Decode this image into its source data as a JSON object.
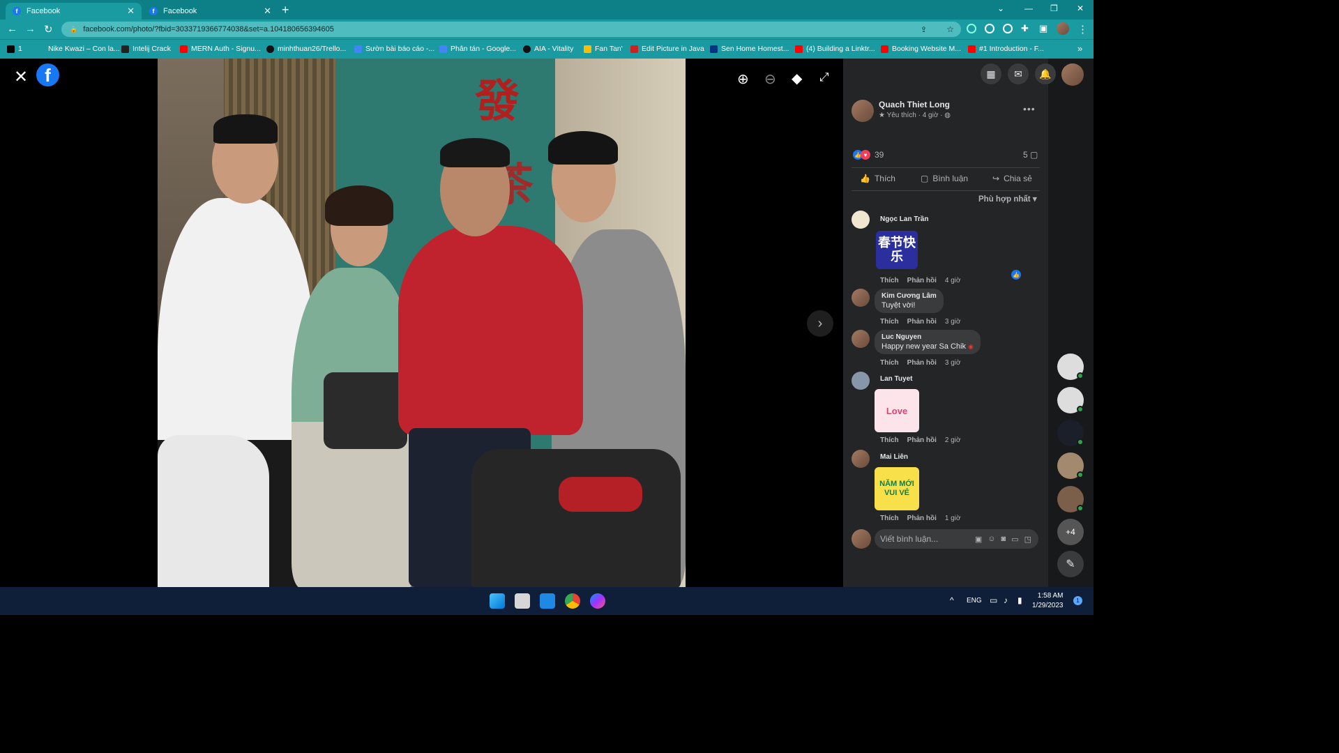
{
  "browser": {
    "tabs": [
      {
        "title": "Facebook",
        "active": true
      },
      {
        "title": "Facebook",
        "active": false
      }
    ],
    "new_tab": "+",
    "url": "facebook.com/photo/?fbid=3033719366774038&set=a.104180656394605",
    "bookmarks": [
      "1",
      "Nike Kwazi – Con la...",
      "Intelij Crack",
      "MERN Auth - Signu...",
      "minhthuan26/Trello...",
      "Sườn bài báo cáo -...",
      "Phân tán - Google...",
      "AIA - Vitality",
      "Fan Tan'",
      "Edit Picture in Java",
      "Sen Home Homest...",
      "(4) Building a Linktr...",
      "Booking Website M...",
      "#1 Introduction - F..."
    ],
    "bookmarks_overflow": "»"
  },
  "viewer": {
    "close_icon": "close-icon",
    "logo_letter": "f",
    "photo_sign_text": "發",
    "photo_sign_text2": "茶",
    "controls": [
      "zoom-in-icon",
      "zoom-out-icon",
      "tag-icon",
      "fullscreen-icon"
    ],
    "next_icon": "chevron-right-icon"
  },
  "post": {
    "author": "Quach Thiet Long",
    "meta": "Yêu thích · 4 giờ ·",
    "reaction_count": "39",
    "comment_count": "5",
    "actions": {
      "like": "Thích",
      "comment": "Bình luận",
      "share": "Chia sẻ"
    },
    "sort_label": "Phù hợp nhất"
  },
  "comments": [
    {
      "name": "Ngọc Lan Trần",
      "sticker": "春节快乐",
      "like": "Thích",
      "reply": "Phản hồi",
      "time": "4 giờ"
    },
    {
      "name": "Kim Cương Lâm",
      "text": "Tuyệt vời!",
      "like": "Thích",
      "reply": "Phản hồi",
      "time": "3 giờ"
    },
    {
      "name": "Luc Nguyen",
      "text": "Happy new year Sa Chik",
      "like": "Thích",
      "reply": "Phản hồi",
      "time": "3 giờ"
    },
    {
      "name": "Lan Tuyet",
      "sticker": "Love",
      "like": "Thích",
      "reply": "Phản hồi",
      "time": "2 giờ"
    },
    {
      "name": "Mai Liên",
      "sticker": "NĂM MỚI VUI VẺ",
      "like": "Thích",
      "reply": "Phản hồi",
      "time": "1 giờ"
    }
  ],
  "composer": {
    "placeholder": "Viết bình luận..."
  },
  "contacts_more": "+4",
  "taskbar": {
    "lang": "ENG",
    "time": "1:58 AM",
    "date": "1/29/2023",
    "notifications": "1"
  },
  "colors": {
    "facebook_blue": "#1877f2",
    "chrome_teal": "#1a9aa1",
    "panel_bg": "#242526"
  }
}
